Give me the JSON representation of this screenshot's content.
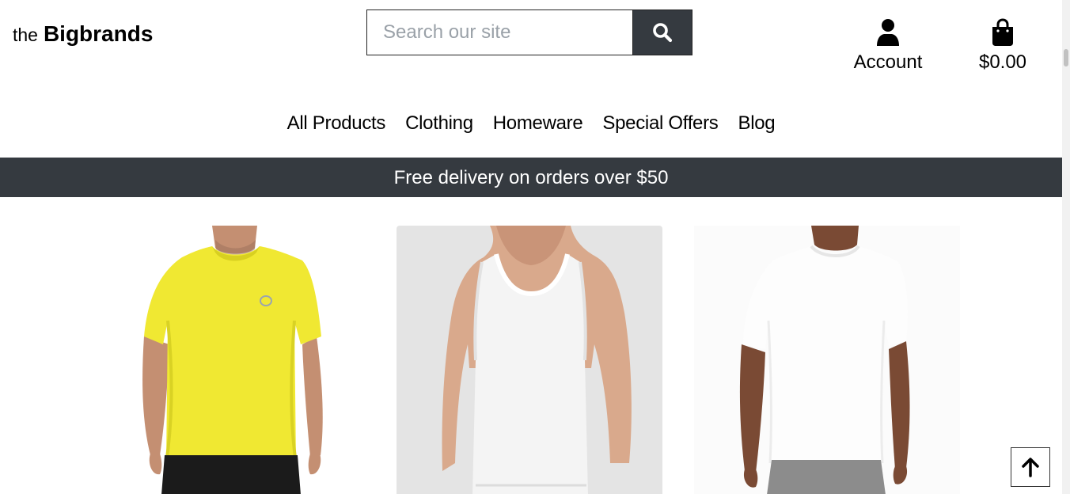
{
  "header": {
    "logo_prefix": "the",
    "logo_brand": "Bigbrands",
    "search_placeholder": "Search our site",
    "account_label": "Account",
    "cart_total": "$0.00"
  },
  "nav": {
    "items": [
      "All Products",
      "Clothing",
      "Homeware",
      "Special Offers",
      "Blog"
    ]
  },
  "banner": {
    "text": "Free delivery on orders over $50"
  },
  "colors": {
    "dark": "#353a40",
    "white": "#ffffff"
  },
  "icons": {
    "search": "search-icon",
    "account": "user-icon",
    "cart": "shopping-bag-icon",
    "back_to_top": "arrow-up-icon"
  }
}
